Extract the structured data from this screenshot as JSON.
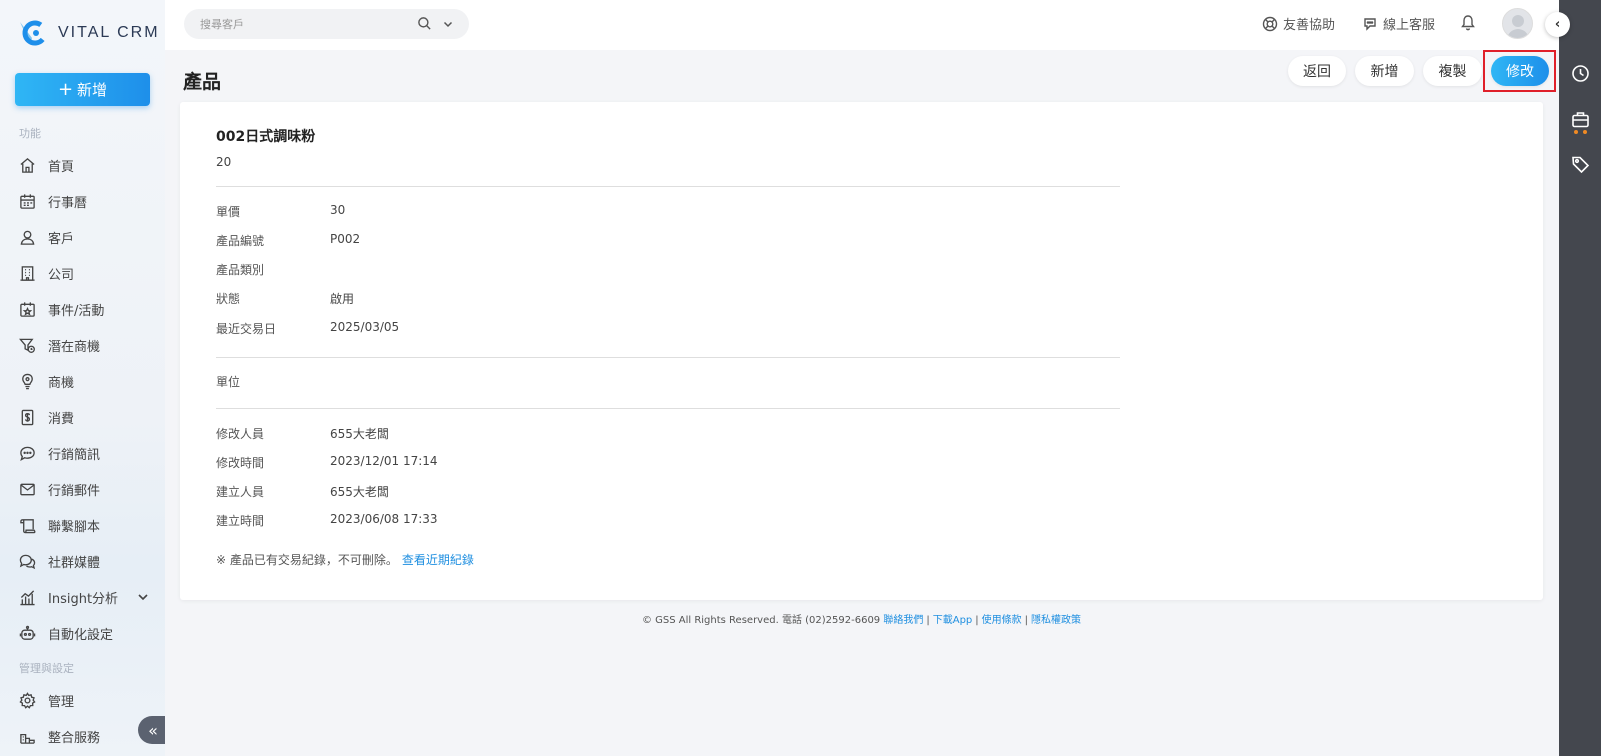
{
  "app": {
    "name": "VITAL CRM"
  },
  "sidebar": {
    "new_label": "新增",
    "section_function": "功能",
    "section_admin": "管理與設定",
    "items": [
      {
        "label": "首頁",
        "icon": "home-icon"
      },
      {
        "label": "行事曆",
        "icon": "calendar-icon"
      },
      {
        "label": "客戶",
        "icon": "user-icon"
      },
      {
        "label": "公司",
        "icon": "building-icon"
      },
      {
        "label": "事件/活動",
        "icon": "event-icon"
      },
      {
        "label": "潛在商機",
        "icon": "funnel-icon"
      },
      {
        "label": "商機",
        "icon": "bulb-icon"
      },
      {
        "label": "消費",
        "icon": "receipt-icon"
      },
      {
        "label": "行銷簡訊",
        "icon": "chat-icon"
      },
      {
        "label": "行銷郵件",
        "icon": "mail-icon"
      },
      {
        "label": "聯繫腳本",
        "icon": "script-icon"
      },
      {
        "label": "社群媒體",
        "icon": "social-icon"
      },
      {
        "label": "Insight分析",
        "icon": "chart-icon"
      },
      {
        "label": "自動化設定",
        "icon": "robot-icon"
      }
    ],
    "admin_items": [
      {
        "label": "管理",
        "icon": "gear-icon"
      },
      {
        "label": "整合服務",
        "icon": "plug-icon"
      }
    ]
  },
  "topbar": {
    "search_placeholder": "搜尋客戶",
    "help_label": "友善協助",
    "support_label": "線上客服"
  },
  "page": {
    "title": "產品",
    "buttons": {
      "back": "返回",
      "add": "新增",
      "copy": "複製",
      "edit": "修改"
    }
  },
  "product": {
    "name": "002日式調味粉",
    "subtitle": "20",
    "fields": [
      {
        "label": "單價",
        "value": "30"
      },
      {
        "label": "產品編號",
        "value": "P002"
      },
      {
        "label": "產品類別",
        "value": ""
      },
      {
        "label": "狀態",
        "value": "啟用"
      },
      {
        "label": "最近交易日",
        "value": "2025/03/05"
      }
    ],
    "unit_label": "單位",
    "unit_value": "",
    "audit": [
      {
        "label": "修改人員",
        "value": "655大老闆"
      },
      {
        "label": "修改時間",
        "value": "2023/12/01 17:14"
      },
      {
        "label": "建立人員",
        "value": "655大老闆"
      },
      {
        "label": "建立時間",
        "value": "2023/06/08 17:33"
      }
    ],
    "note": "※ 產品已有交易紀錄，不可刪除。",
    "note_link": "查看近期紀錄"
  },
  "footer": {
    "copyright": "© GSS All Rights Reserved. 電話 (02)2592-6609",
    "links": [
      "聯絡我們",
      "下載App",
      "使用條款",
      "隱私權政策"
    ]
  },
  "colors": {
    "accent": "#1e8fea",
    "rail": "#44474e",
    "highlight": "#e0202a"
  }
}
